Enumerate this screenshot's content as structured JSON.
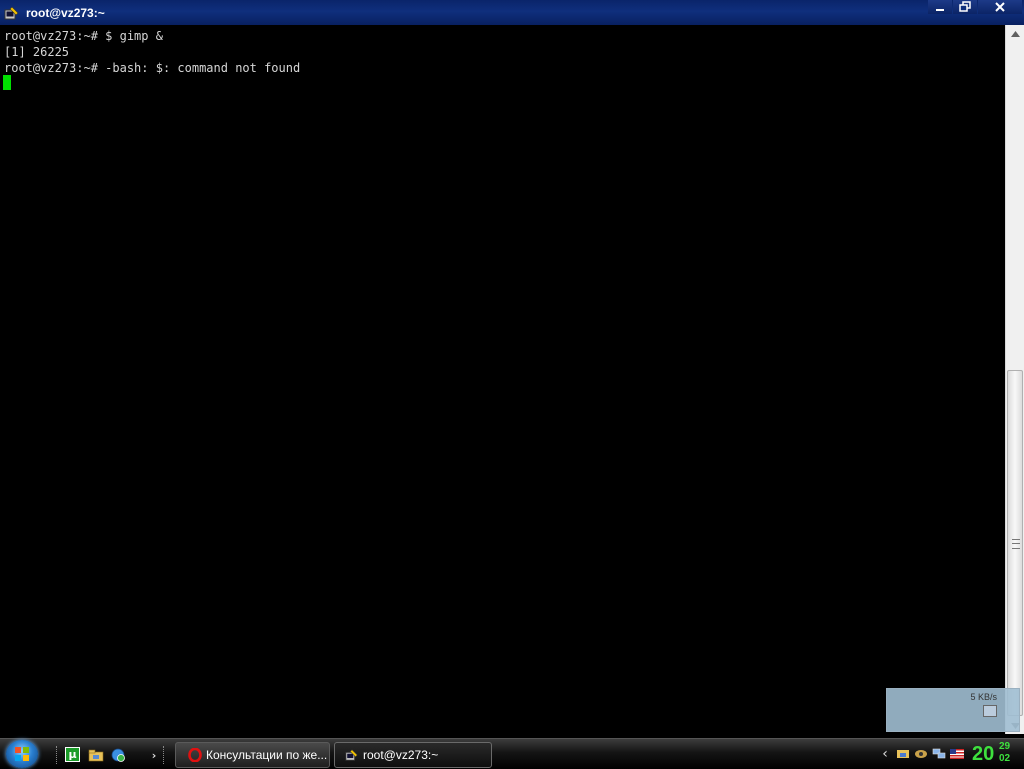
{
  "window": {
    "title": "root@vz273:~",
    "controls": {
      "minimize": "minimize",
      "restore": "restore",
      "close": "close"
    }
  },
  "terminal": {
    "lines": [
      "root@vz273:~# $ gimp &",
      "[1] 26225",
      "root@vz273:~# -bash: $: command not found"
    ],
    "cursor_color": "#00e000",
    "text_color": "#d6d6d6",
    "background": "#000000"
  },
  "net_meter": {
    "rate": "5 KB/s"
  },
  "taskbar": {
    "quick_launch": [
      "utorrent-icon",
      "network-folder-icon",
      "browser-icon"
    ],
    "overflow_glyph": "›",
    "tasks": [
      {
        "label": "Консультации по же...",
        "icon": "opera-icon",
        "active": false
      },
      {
        "label": "root@vz273:~",
        "icon": "putty-icon",
        "active": true
      }
    ],
    "tray": {
      "chevron": "‹",
      "icons": [
        "network-share-icon",
        "sync-icon",
        "network-connections-icon",
        "language-flag-icon"
      ]
    },
    "clock": {
      "hours": "20",
      "minutes": "29",
      "seconds": "02",
      "color": "#3ee03e"
    }
  }
}
